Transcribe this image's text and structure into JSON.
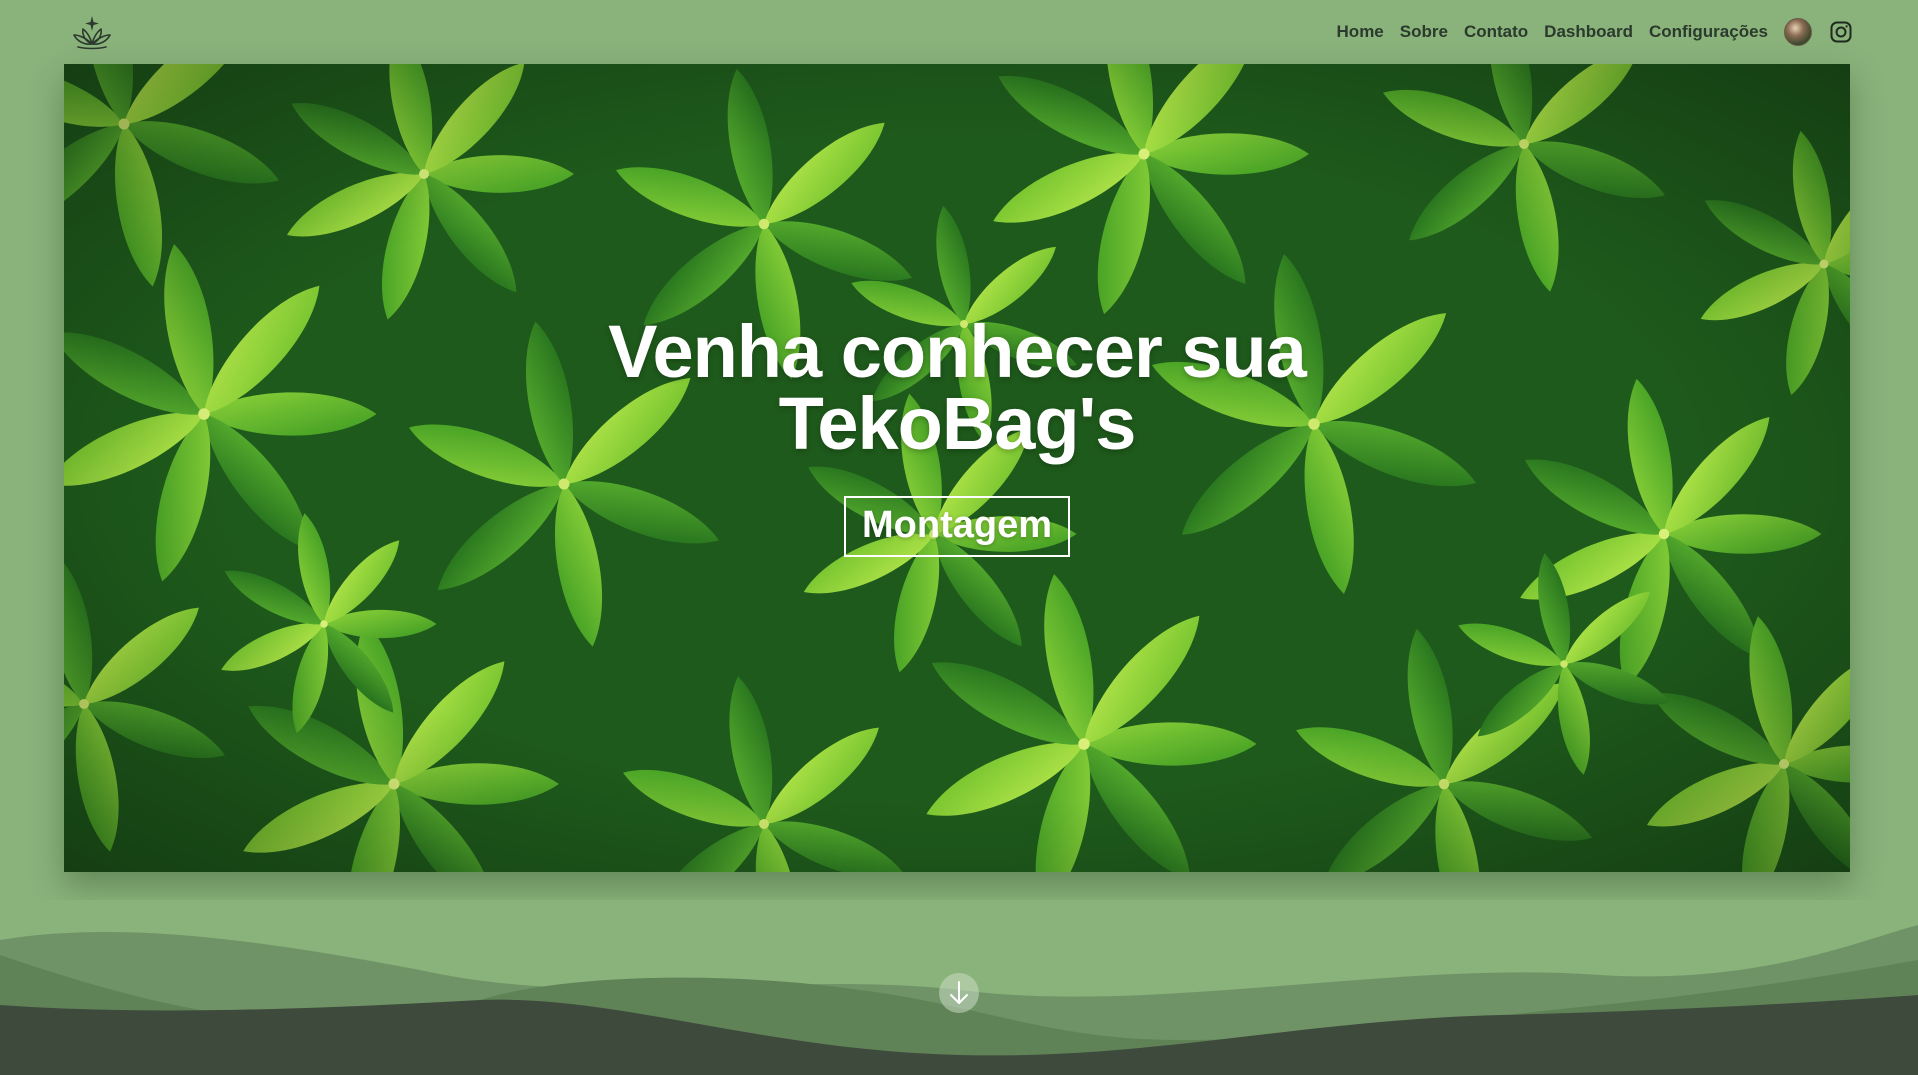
{
  "header": {
    "nav": [
      {
        "label": "Home"
      },
      {
        "label": "Sobre"
      },
      {
        "label": "Contato"
      },
      {
        "label": "Dashboard"
      },
      {
        "label": "Configurações"
      }
    ]
  },
  "hero": {
    "title": "Venha conhecer sua TekoBag's",
    "button_label": "Montagem"
  },
  "icons": {
    "logo": "lotus-logo-icon",
    "avatar": "user-avatar",
    "social": "instagram-icon",
    "scroll": "arrow-down-icon"
  },
  "colors": {
    "background": "#8ab27b",
    "nav_text": "#2b3a2c",
    "hero_text": "#ffffff",
    "wave_dark": "#3e4a3c",
    "wave_mid": "#6a8f61"
  }
}
